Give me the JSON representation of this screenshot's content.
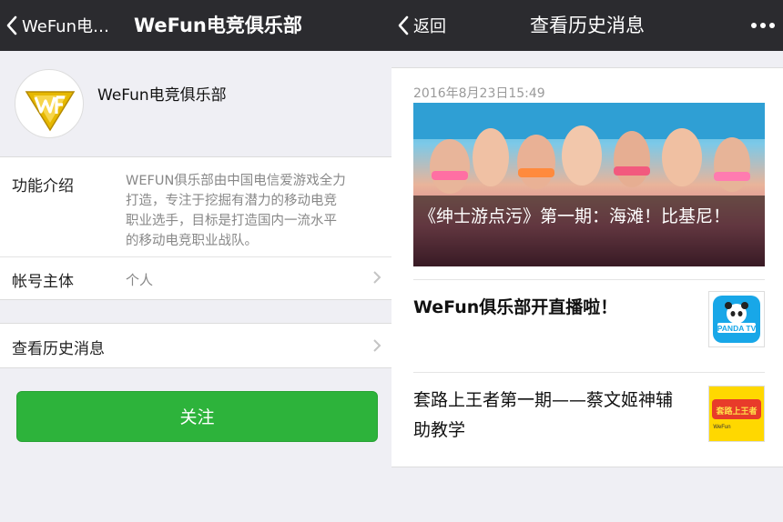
{
  "left": {
    "navbar": {
      "back_label": "WeFun电…",
      "title": "WeFun电竞俱乐部"
    },
    "profile": {
      "name": "WeFun电竞俱乐部"
    },
    "intro": {
      "label": "功能介绍",
      "lines": [
        "WEFUN俱乐部由中国电信爱游戏全力",
        "打造，专注于挖掘有潜力的移动电竞",
        "职业选手，目标是打造国内一流水平",
        "的移动电竞职业战队。"
      ]
    },
    "owner": {
      "label": "帐号主体",
      "value": "个人"
    },
    "history": {
      "label": "查看历史消息"
    },
    "follow_button": "关注"
  },
  "right": {
    "navbar": {
      "back_label": "返回",
      "title": "查看历史消息"
    },
    "date": "2016年8月23日15:49",
    "hero": {
      "title": "《绅士游点污》第一期：海滩！比基尼！"
    },
    "items": [
      {
        "title": "WeFun俱乐部开直播啦！",
        "thumb_text": "PANDA TV"
      },
      {
        "title": "套路上王者第一期——蔡文姬神辅助教学",
        "thumb_text": "套路上王者",
        "thumb_sub": "WeFun"
      }
    ]
  },
  "colors": {
    "navbar": "#2b2b2f",
    "follow_button": "#2db33b",
    "background": "#efeff4",
    "logo_gold": "#e6b800"
  },
  "icons": [
    "back-chevron-icon",
    "more-dots-icon",
    "chevron-right-icon",
    "wefun-logo-icon",
    "panda-tv-logo-icon"
  ]
}
